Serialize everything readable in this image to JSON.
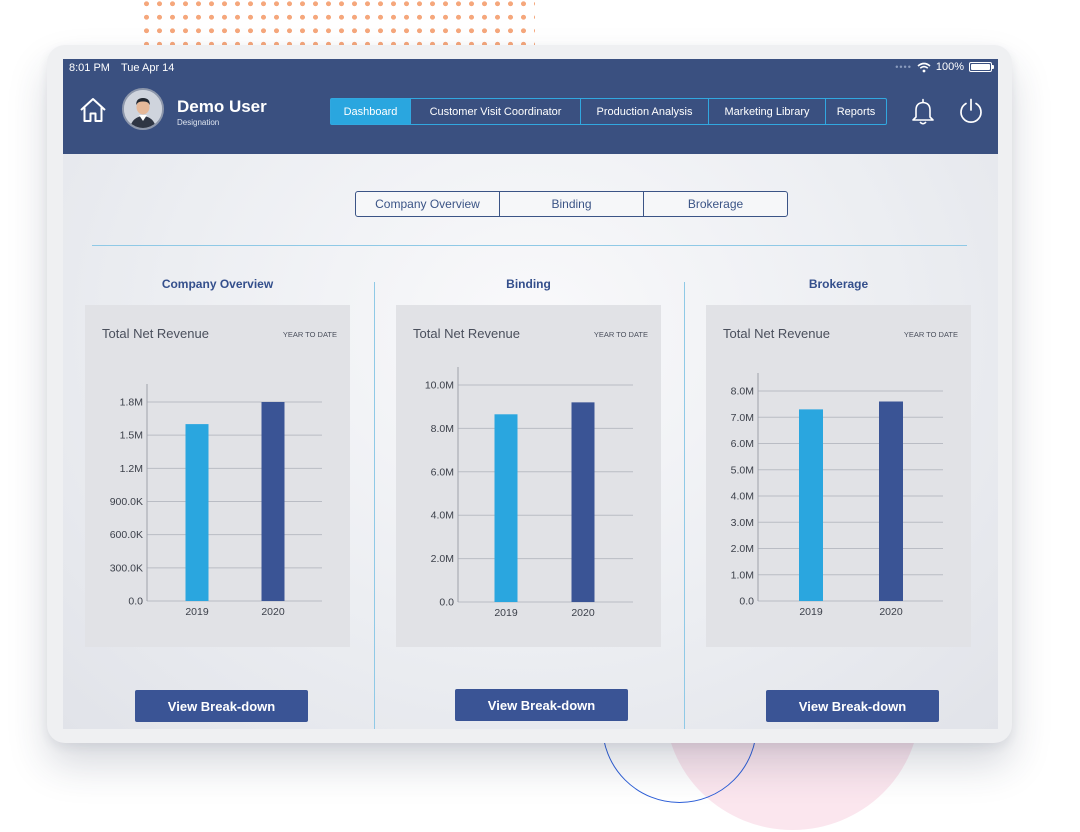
{
  "status_bar": {
    "time": "8:01 PM",
    "date": "Tue Apr 14",
    "battery": "100%"
  },
  "user": {
    "name": "Demo User",
    "role": "Designation"
  },
  "nav": [
    {
      "label": "Dashboard",
      "active": true
    },
    {
      "label": "Customer Visit Coordinator",
      "active": false
    },
    {
      "label": "Production Analysis",
      "active": false
    },
    {
      "label": "Marketing Library",
      "active": false
    },
    {
      "label": "Reports",
      "active": false
    }
  ],
  "segments": [
    "Company Overview",
    "Binding",
    "Brokerage"
  ],
  "colors": {
    "header": "#3a5080",
    "accent": "#2aa6df",
    "bar_2019": "#2aa6df",
    "bar_2020": "#3a5495"
  },
  "icons": [
    "home-icon",
    "bell-icon",
    "power-icon",
    "wifi-icon",
    "battery-icon"
  ],
  "panels": [
    {
      "heading": "Company Overview",
      "card_title": "Total Net Revenue",
      "card_tag": "YEAR TO DATE",
      "button": "View Break-down"
    },
    {
      "heading": "Binding",
      "card_title": "Total Net Revenue",
      "card_tag": "YEAR TO DATE",
      "button": "View Break-down"
    },
    {
      "heading": "Brokerage",
      "card_title": "Total Net Revenue",
      "card_tag": "YEAR TO DATE",
      "button": "View Break-down"
    }
  ],
  "chart_data": [
    {
      "type": "bar",
      "title": "Total Net Revenue",
      "categories": [
        "2019",
        "2020"
      ],
      "values": [
        1600000,
        1800000
      ],
      "ylim": [
        0,
        1800000
      ],
      "yticks": [
        0,
        300000,
        600000,
        900000,
        1200000,
        1500000,
        1800000
      ],
      "ytick_labels": [
        "0.0",
        "300.0K",
        "600.0K",
        "900.0K",
        "1.2M",
        "1.5M",
        "1.8M"
      ],
      "grid": true
    },
    {
      "type": "bar",
      "title": "Total Net Revenue",
      "categories": [
        "2019",
        "2020"
      ],
      "values": [
        8650000,
        9200000
      ],
      "ylim": [
        0,
        10000000
      ],
      "yticks": [
        0,
        2000000,
        4000000,
        6000000,
        8000000,
        10000000
      ],
      "ytick_labels": [
        "0.0",
        "2.0M",
        "4.0M",
        "6.0M",
        "8.0M",
        "10.0M"
      ],
      "grid": true
    },
    {
      "type": "bar",
      "title": "Total Net Revenue",
      "categories": [
        "2019",
        "2020"
      ],
      "values": [
        7300000,
        7600000
      ],
      "ylim": [
        0,
        8000000
      ],
      "yticks": [
        0,
        1000000,
        2000000,
        3000000,
        4000000,
        5000000,
        6000000,
        7000000,
        8000000
      ],
      "ytick_labels": [
        "0.0",
        "1.0M",
        "2.0M",
        "3.0M",
        "4.0M",
        "5.0M",
        "6.0M",
        "7.0M",
        "8.0M"
      ],
      "grid": true
    }
  ]
}
